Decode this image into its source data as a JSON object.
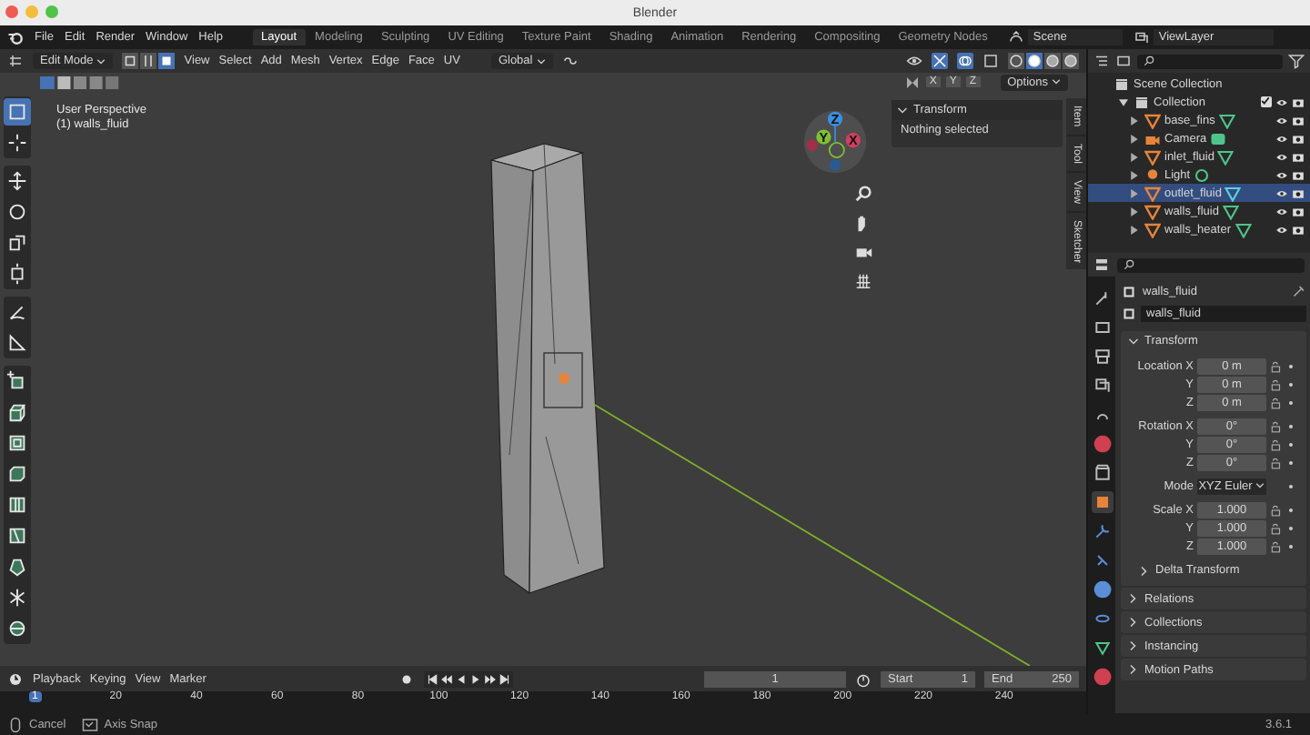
{
  "window": {
    "title": "Blender"
  },
  "menu": [
    "File",
    "Edit",
    "Render",
    "Window",
    "Help"
  ],
  "workspaces": [
    {
      "label": "Layout",
      "selected": true
    },
    {
      "label": "Modeling",
      "selected": false
    },
    {
      "label": "Sculpting",
      "selected": false
    },
    {
      "label": "UV Editing",
      "selected": false
    },
    {
      "label": "Texture Paint",
      "selected": false
    },
    {
      "label": "Shading",
      "selected": false
    },
    {
      "label": "Animation",
      "selected": false
    },
    {
      "label": "Rendering",
      "selected": false
    },
    {
      "label": "Compositing",
      "selected": false
    },
    {
      "label": "Geometry Nodes",
      "selected": false
    }
  ],
  "scene": {
    "value": "Scene"
  },
  "view_layer": {
    "value": "ViewLayer"
  },
  "viewport_header": {
    "mode": "Edit Mode",
    "select_modes": [
      {
        "kind": "vertex",
        "selected": false
      },
      {
        "kind": "edge",
        "selected": false
      },
      {
        "kind": "face",
        "selected": true
      }
    ],
    "menus": [
      "View",
      "Select",
      "Add",
      "Mesh",
      "Vertex",
      "Edge",
      "Face",
      "UV"
    ],
    "orientation": "Global",
    "shading": [
      {
        "kind": "wireframe",
        "selected": false
      },
      {
        "kind": "solid",
        "selected": true
      },
      {
        "kind": "material",
        "selected": false
      },
      {
        "kind": "rendered",
        "selected": false
      }
    ],
    "axes": [
      "X",
      "Y",
      "Z"
    ],
    "options": "Options"
  },
  "viewport": {
    "view_name": "User Perspective",
    "object_label": "(1) walls_fluid",
    "tool_groups": [
      [
        {
          "kind": "select",
          "selected": true
        },
        {
          "kind": "cursor",
          "selected": false
        }
      ],
      [
        {
          "kind": "move",
          "selected": false
        },
        {
          "kind": "rotate",
          "selected": false
        },
        {
          "kind": "scale",
          "selected": false
        },
        {
          "kind": "transform",
          "selected": false
        }
      ],
      [
        {
          "kind": "annotate",
          "selected": false
        },
        {
          "kind": "measure",
          "selected": false
        }
      ],
      [
        {
          "kind": "add_cube",
          "selected": false
        },
        {
          "kind": "extrude",
          "selected": false
        },
        {
          "kind": "inset",
          "selected": false
        },
        {
          "kind": "bevel",
          "selected": false
        },
        {
          "kind": "loop_cut",
          "selected": false
        },
        {
          "kind": "knife",
          "selected": false
        },
        {
          "kind": "poly_build",
          "selected": false
        },
        {
          "kind": "spin",
          "selected": false
        },
        {
          "kind": "smooth",
          "selected": false
        }
      ]
    ],
    "gizmo": {
      "z": "Z",
      "y": "Y",
      "x": "X"
    },
    "sidebar": {
      "panel": "Transform",
      "expanded": true,
      "message": "Nothing selected",
      "tabs": [
        "Item",
        "Tool",
        "View",
        "Sketcher"
      ]
    }
  },
  "timeline": {
    "menus": [
      "Playback",
      "Keying",
      "View",
      "Marker"
    ],
    "current_frame": "1",
    "start": {
      "label": "Start",
      "value": "1"
    },
    "end": {
      "label": "End",
      "value": "250"
    },
    "ruler": [
      {
        "label": "1",
        "selected": true
      },
      {
        "label": "20",
        "selected": false
      },
      {
        "label": "40",
        "selected": false
      },
      {
        "label": "60",
        "selected": false
      },
      {
        "label": "80",
        "selected": false
      },
      {
        "label": "100",
        "selected": false
      },
      {
        "label": "120",
        "selected": false
      },
      {
        "label": "140",
        "selected": false
      },
      {
        "label": "160",
        "selected": false
      },
      {
        "label": "180",
        "selected": false
      },
      {
        "label": "200",
        "selected": false
      },
      {
        "label": "220",
        "selected": false
      },
      {
        "label": "240",
        "selected": false
      }
    ]
  },
  "outliner": {
    "tree": [
      {
        "label": "Scene Collection",
        "children": [
          {
            "label": "Collection",
            "expanded": true,
            "checked": true,
            "children": [
              {
                "label": "base_fins",
                "kind": "mesh",
                "selected": false
              },
              {
                "label": "Camera",
                "kind": "camera",
                "selected": false
              },
              {
                "label": "inlet_fluid",
                "kind": "mesh",
                "selected": false
              },
              {
                "label": "Light",
                "kind": "light",
                "selected": false
              },
              {
                "label": "outlet_fluid",
                "kind": "mesh",
                "selected": true
              },
              {
                "label": "walls_fluid",
                "kind": "mesh",
                "selected": false
              },
              {
                "label": "walls_heater",
                "kind": "mesh",
                "selected": false
              }
            ]
          }
        ]
      }
    ]
  },
  "properties": {
    "tabs": [
      {
        "kind": "tool",
        "selected": false
      },
      {
        "kind": "render",
        "selected": false
      },
      {
        "kind": "output",
        "selected": false
      },
      {
        "kind": "view_layer",
        "selected": false
      },
      {
        "kind": "scene",
        "selected": false
      },
      {
        "kind": "world",
        "selected": false
      },
      {
        "kind": "collection",
        "selected": false
      },
      {
        "kind": "object",
        "selected": true
      },
      {
        "kind": "modifiers",
        "selected": false
      },
      {
        "kind": "particles",
        "selected": false
      },
      {
        "kind": "physics",
        "selected": false
      },
      {
        "kind": "constraints",
        "selected": false
      },
      {
        "kind": "data",
        "selected": false
      },
      {
        "kind": "material",
        "selected": false
      }
    ],
    "object_name": "walls_fluid",
    "data_name": "walls_fluid",
    "panel": {
      "title": "Transform",
      "expanded": true,
      "groups": [
        {
          "rows": [
            {
              "kind": "field",
              "label": "Location X",
              "value": "0 m"
            },
            {
              "kind": "field",
              "label": "Y",
              "value": "0 m"
            },
            {
              "kind": "field",
              "label": "Z",
              "value": "0 m"
            }
          ]
        },
        {
          "rows": [
            {
              "kind": "field",
              "label": "Rotation X",
              "value": "0°"
            },
            {
              "kind": "field",
              "label": "Y",
              "value": "0°"
            },
            {
              "kind": "field",
              "label": "Z",
              "value": "0°"
            }
          ]
        },
        {
          "rows": [
            {
              "kind": "dropdown",
              "label": "Mode",
              "value": "XYZ Euler"
            }
          ]
        },
        {
          "rows": [
            {
              "kind": "field",
              "label": "Scale X",
              "value": "1.000"
            },
            {
              "kind": "field",
              "label": "Y",
              "value": "1.000"
            },
            {
              "kind": "field",
              "label": "Z",
              "value": "1.000"
            }
          ]
        }
      ],
      "subpanel": "Delta Transform"
    },
    "collapsed_panels": [
      "Relations",
      "Collections",
      "Instancing",
      "Motion Paths"
    ]
  },
  "status_bar": {
    "hints": [
      {
        "kind": "mouse",
        "label": "Cancel"
      },
      {
        "kind": "key",
        "label": "Axis Snap"
      }
    ],
    "version": "3.6.1"
  }
}
